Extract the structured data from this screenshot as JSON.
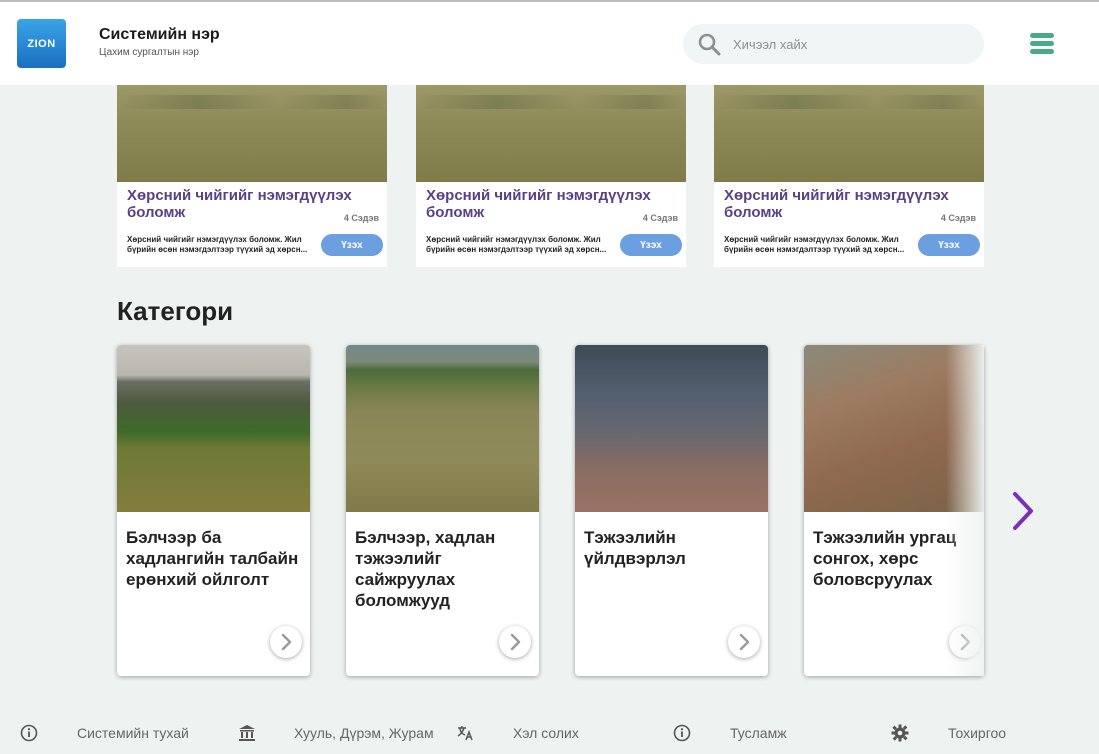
{
  "header": {
    "logo_text": "ZION",
    "system_name": "Системийн нэр",
    "system_subtitle": "Цахим сургалтын нэр",
    "search_placeholder": "Хичээл хайх",
    "menu_icon": "hamburger-icon",
    "accent_color": "#4aaa86"
  },
  "courses": [
    {
      "title": "Хөрсний чийгийг нэмэгдүүлэх боломж",
      "topics": "4 Сэдэв",
      "description": "Хөрсний чийгийг нэмэгдүүлэх боломж. Жил бүрийн өсөн нэмэгдэлтээр түүхий эд хөрсн...",
      "button": "Үзэх"
    },
    {
      "title": "Хөрсний чийгийг нэмэгдүүлэх боломж",
      "topics": "4 Сэдэв",
      "description": "Хөрсний чийгийг нэмэгдүүлэх боломж. Жил бүрийн өсөн нэмэгдэлтээр түүхий эд хөрсн...",
      "button": "Үзэх"
    },
    {
      "title": "Хөрсний чийгийг нэмэгдүүлэх боломж",
      "topics": "4 Сэдэв",
      "description": "Хөрсний чийгийг нэмэгдүүлэх боломж. Жил бүрийн өсөн нэмэгдэлтээр түүхий эд хөрсн...",
      "button": "Үзэх"
    }
  ],
  "category_section": {
    "heading": "Категори",
    "items": [
      {
        "label": "Бэлчээр ба хадлангийн талбайн ерөнхий ойлголт"
      },
      {
        "label": "Бэлчээр, хадлан тэжээлийг сайжруулах боломжууд"
      },
      {
        "label": "Тэжээлийн үйлдвэрлэл"
      },
      {
        "label": "Тэжээлийн ургац сонгох, хөрс боловсруулах"
      }
    ],
    "next_icon": "chevron-right-icon",
    "next_color": "#7b2fc0"
  },
  "footer": {
    "items": [
      {
        "label": "Системийн тухай",
        "icon": "info-icon"
      },
      {
        "label": "Хууль, Дүрэм, Журам",
        "icon": "bank-icon"
      },
      {
        "label": "Хэл солих",
        "icon": "language-icon"
      },
      {
        "label": "Тусламж",
        "icon": "help-icon"
      },
      {
        "label": "Тохиргоо",
        "icon": "gear-icon"
      }
    ]
  }
}
